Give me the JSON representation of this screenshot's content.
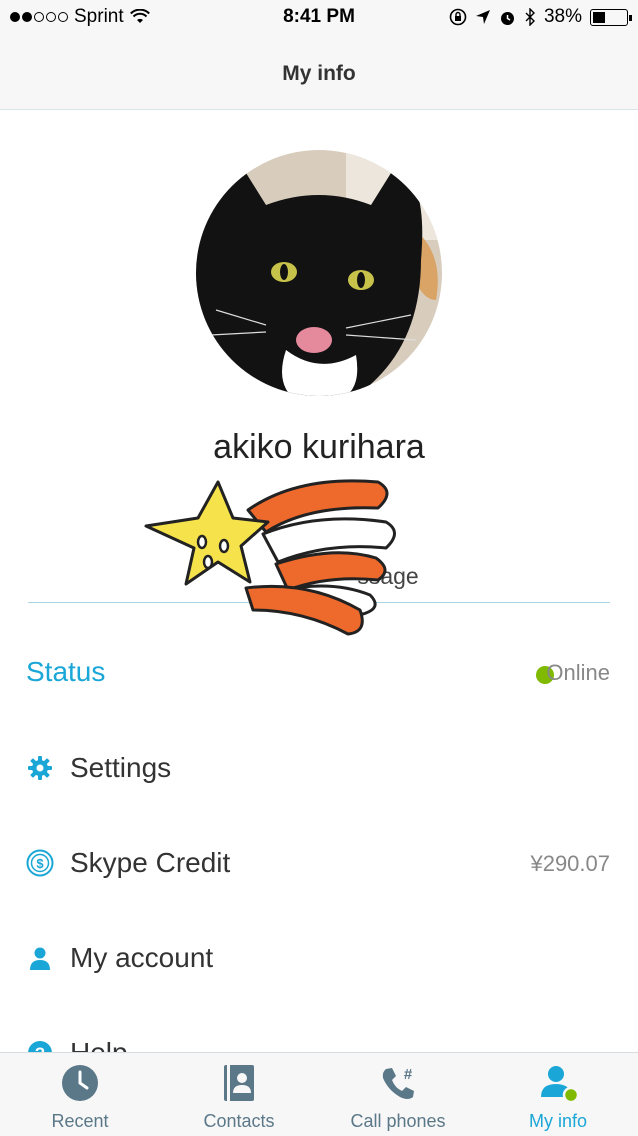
{
  "status_bar": {
    "carrier": "Sprint",
    "time": "8:41 PM",
    "battery": "38%",
    "signal_bars": 2,
    "battery_level": 0.38
  },
  "header": {
    "title": "My info"
  },
  "profile": {
    "display_name": "akiko kurihara",
    "mood_text": "ssage"
  },
  "status": {
    "label": "Status",
    "value": "Online",
    "color": "#7fba00"
  },
  "menu": {
    "settings": {
      "label": "Settings",
      "icon": "gear-icon"
    },
    "skype_credit": {
      "label": "Skype Credit",
      "value": "¥290.07",
      "icon": "dollar-coin-icon"
    },
    "my_account": {
      "label": "My account",
      "icon": "person-icon"
    },
    "help": {
      "label": "Help",
      "icon": "help-icon"
    }
  },
  "tabs": [
    {
      "label": "Recent",
      "icon": "clock-icon",
      "active": false
    },
    {
      "label": "Contacts",
      "icon": "contact-book-icon",
      "active": false
    },
    {
      "label": "Call phones",
      "icon": "phone-keypad-icon",
      "active": false
    },
    {
      "label": "My info",
      "icon": "person-online-icon",
      "active": true
    }
  ],
  "colors": {
    "accent": "#1aa6d6",
    "online": "#7fba00",
    "tab_inactive": "#5b7889"
  }
}
